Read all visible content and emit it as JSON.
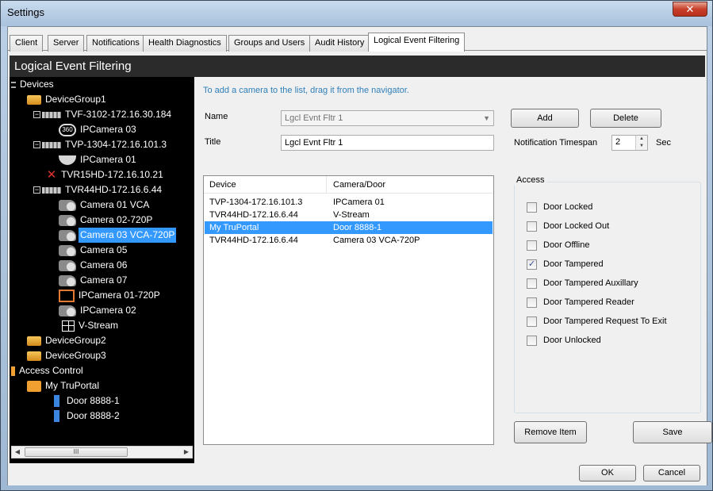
{
  "window": {
    "title": "Settings",
    "close_glyph": "✕"
  },
  "tabs": [
    {
      "label": "Client"
    },
    {
      "label": "Server"
    },
    {
      "label": "Notifications"
    },
    {
      "label": "Health Diagnostics"
    },
    {
      "label": "Groups and Users"
    },
    {
      "label": "Audit History"
    },
    {
      "label": "Logical Event Filtering",
      "active": true
    }
  ],
  "panel": {
    "header": "Logical Event Filtering"
  },
  "tree": {
    "root_label": "Devices",
    "items": [
      {
        "label": "DeviceGroup1",
        "icon": "folder-icon"
      },
      {
        "label": "TVF-3102-172.16.30.184",
        "icon": "dvr-icon"
      },
      {
        "label": "IPCamera 03",
        "icon": "camera-360-icon"
      },
      {
        "label": "TVP-1304-172.16.101.3",
        "icon": "dvr-icon"
      },
      {
        "label": "IPCamera 01",
        "icon": "dome-camera-icon"
      },
      {
        "label": "TVR15HD-172.16.10.21",
        "icon": "offline-x-icon"
      },
      {
        "label": "TVR44HD-172.16.6.44",
        "icon": "dvr-icon"
      },
      {
        "label": "Camera 01 VCA",
        "icon": "bullet-camera-icon"
      },
      {
        "label": "Camera 02-720P",
        "icon": "bullet-camera-icon"
      },
      {
        "label": "Camera 03 VCA-720P",
        "icon": "bullet-camera-icon",
        "selected": true
      },
      {
        "label": "Camera 05",
        "icon": "bullet-camera-icon"
      },
      {
        "label": "Camera 06",
        "icon": "bullet-camera-icon"
      },
      {
        "label": "Camera 07",
        "icon": "bullet-camera-icon"
      },
      {
        "label": "IPCamera 01-720P",
        "icon": "ip-camera-icon"
      },
      {
        "label": "IPCamera 02",
        "icon": "bullet-camera-icon"
      },
      {
        "label": "V-Stream",
        "icon": "grid-icon"
      },
      {
        "label": "DeviceGroup2",
        "icon": "folder-icon"
      },
      {
        "label": "DeviceGroup3",
        "icon": "folder-icon"
      },
      {
        "label": "Access Control",
        "icon": "access-control-icon"
      },
      {
        "label": "My TruPortal",
        "icon": "truportal-icon"
      },
      {
        "label": "Door 8888-1",
        "icon": "door-icon"
      },
      {
        "label": "Door 8888-2",
        "icon": "door-icon"
      }
    ],
    "hscroll_thumb": "III"
  },
  "form": {
    "hint": "To add a camera to the list, drag it from the navigator.",
    "name_label": "Name",
    "name_value": "Lgcl Evnt Fltr 1",
    "title_label": "Title",
    "title_value": "Lgcl Evnt Fltr 1",
    "add_label": "Add",
    "delete_label": "Delete",
    "timespan_label": "Notification Timespan",
    "timespan_value": "2",
    "timespan_unit": "Sec"
  },
  "list": {
    "col_device": "Device",
    "col_camera": "Camera/Door",
    "rows": [
      {
        "device": "TVP-1304-172.16.101.3",
        "camera": "IPCamera 01"
      },
      {
        "device": "TVR44HD-172.16.6.44",
        "camera": "V-Stream"
      },
      {
        "device": "My TruPortal",
        "camera": "Door 8888-1",
        "selected": true
      },
      {
        "device": "TVR44HD-172.16.6.44",
        "camera": "Camera 03 VCA-720P"
      }
    ]
  },
  "access": {
    "title": "Access",
    "options": [
      {
        "label": "Door Locked",
        "checked": false
      },
      {
        "label": "Door Locked Out",
        "checked": false
      },
      {
        "label": "Door Offline",
        "checked": false
      },
      {
        "label": "Door Tampered",
        "checked": true
      },
      {
        "label": "Door Tampered Auxillary",
        "checked": false
      },
      {
        "label": "Door Tampered Reader",
        "checked": false
      },
      {
        "label": "Door Tampered Request To Exit",
        "checked": false
      },
      {
        "label": "Door Unlocked",
        "checked": false
      }
    ]
  },
  "buttons": {
    "remove_item": "Remove Item",
    "save": "Save",
    "ok": "OK",
    "cancel": "Cancel"
  }
}
